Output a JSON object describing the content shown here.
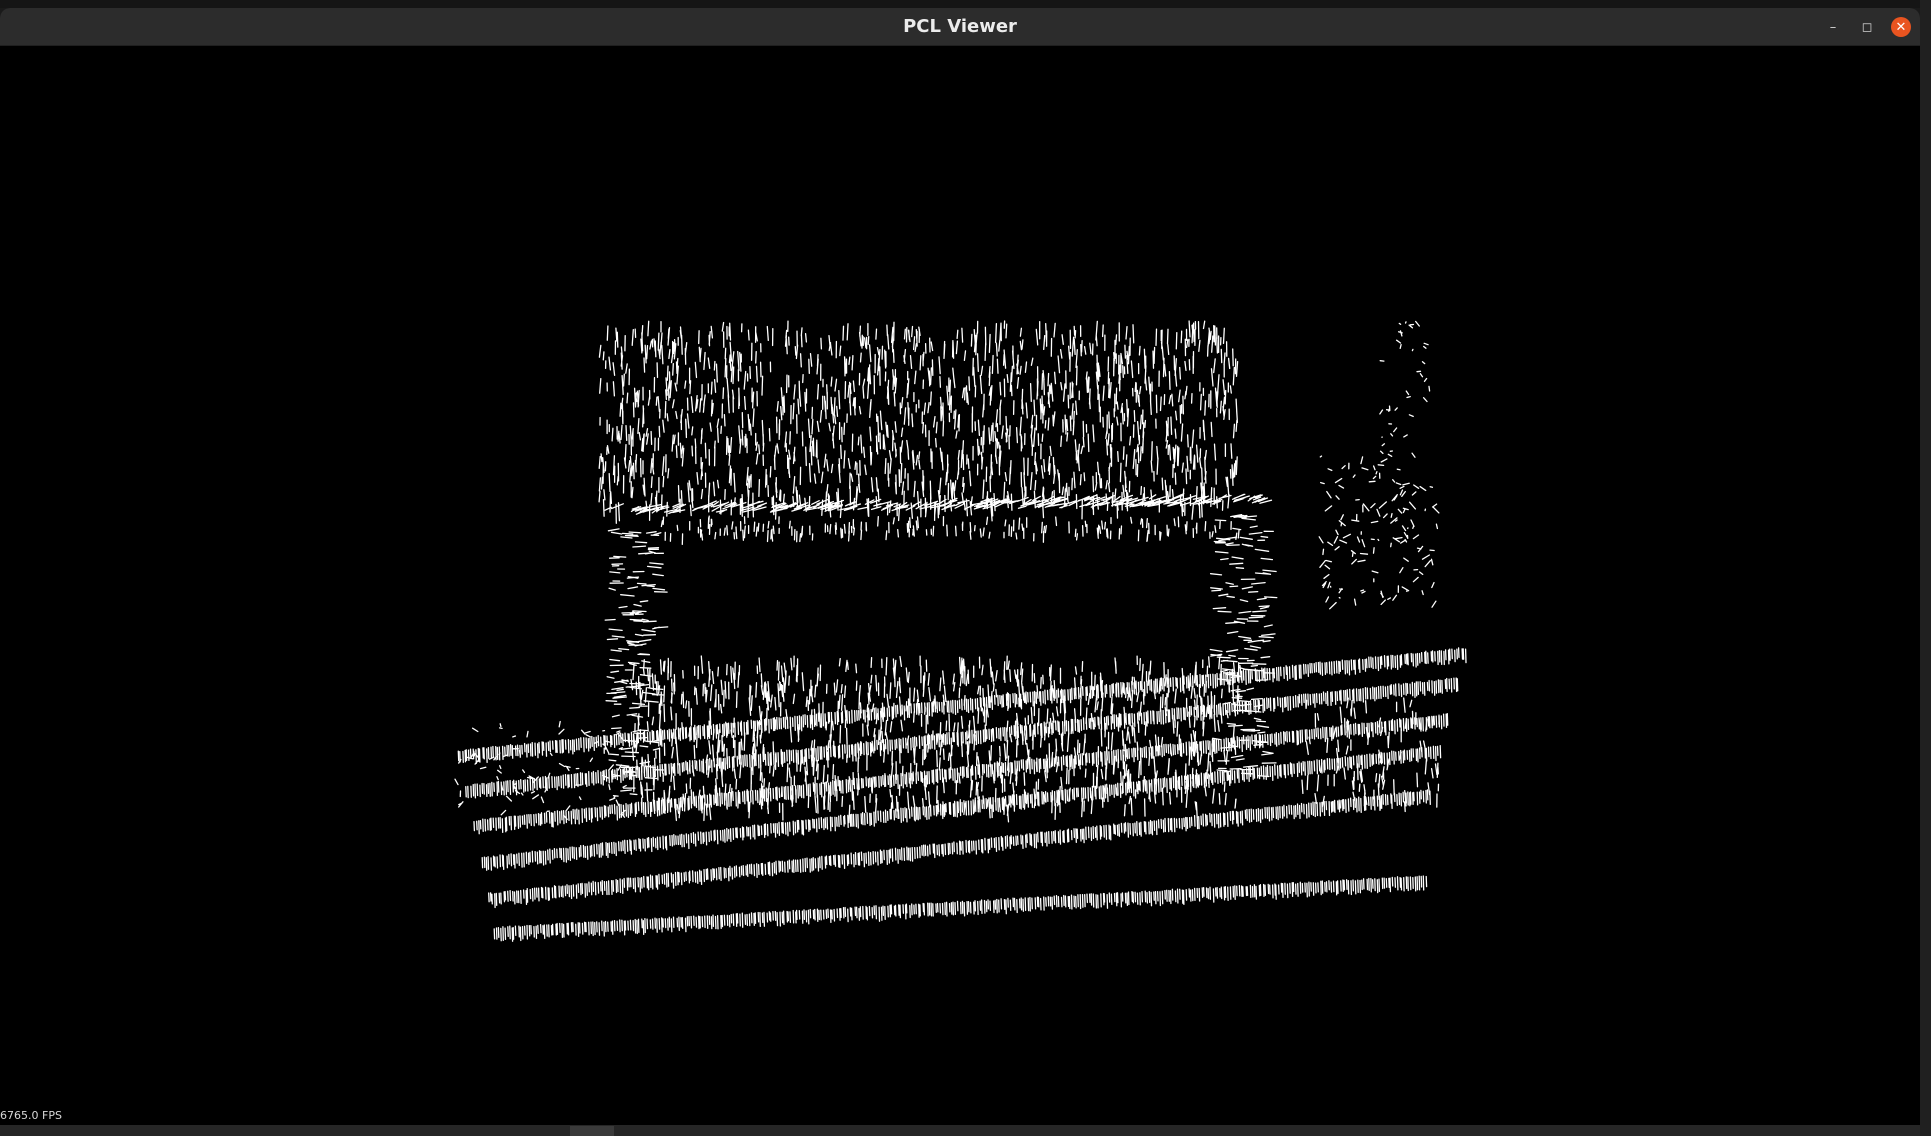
{
  "window": {
    "title": "PCL Viewer",
    "controls": {
      "minimize_icon": "minimize-icon",
      "maximize_icon": "maximize-icon",
      "close_icon": "close-icon"
    }
  },
  "viewer": {
    "fps_text": "6765.0 FPS",
    "background": "#000000",
    "point_color": "#ffffff"
  },
  "colors": {
    "titlebar": "#2c2c2c",
    "close_button": "#e95420"
  }
}
